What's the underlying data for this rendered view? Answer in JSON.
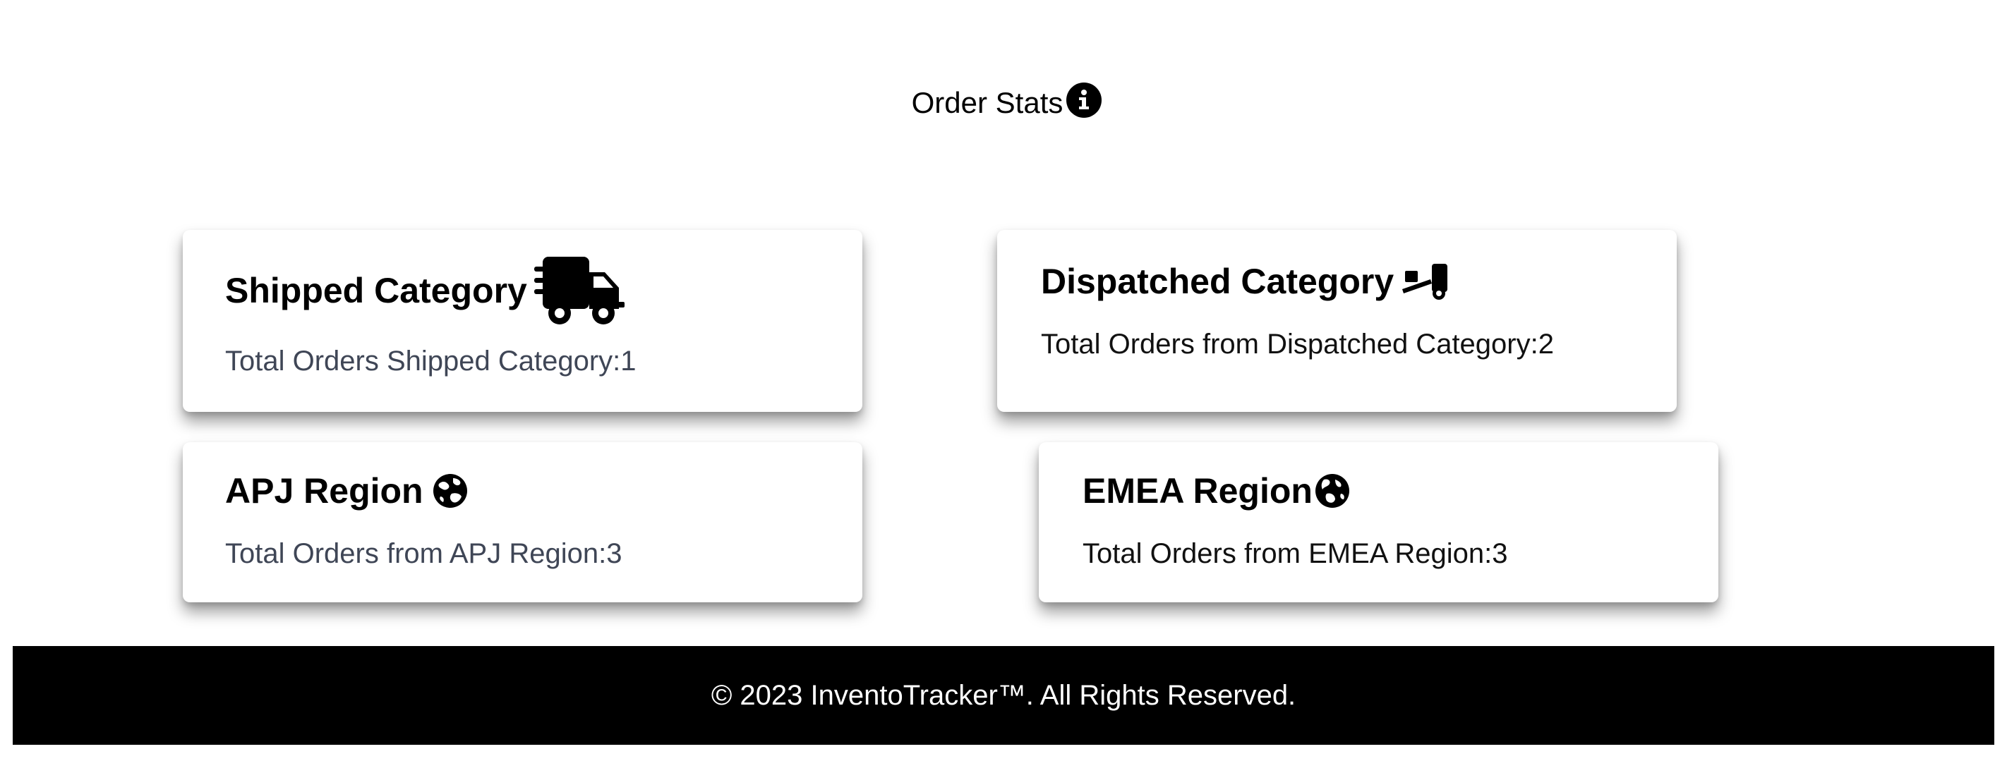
{
  "header": {
    "title": "Order Stats",
    "info_icon": "info-circle-icon"
  },
  "cards": {
    "shipped": {
      "heading": "Shipped Category",
      "icon": "truck-fast-icon",
      "text": "Total Orders Shipped Category:1"
    },
    "dispatched": {
      "heading": "Dispatched Category",
      "icon": "truck-ramp-box-icon",
      "text": "Total Orders from Dispatched Category:2"
    },
    "apj": {
      "heading": "APJ Region",
      "icon": "globe-asia-icon",
      "text": "Total Orders from APJ Region:3"
    },
    "emea": {
      "heading": "EMEA Region",
      "icon": "globe-europe-icon",
      "text": "Total Orders from EMEA Region:3"
    }
  },
  "footer": {
    "text": "© 2023 InventoTracker™. All Rights Reserved."
  },
  "colors": {
    "background": "#ffffff",
    "footer_bg": "#000000",
    "footer_text": "#ffffff",
    "muted_text": "#3f4656"
  }
}
